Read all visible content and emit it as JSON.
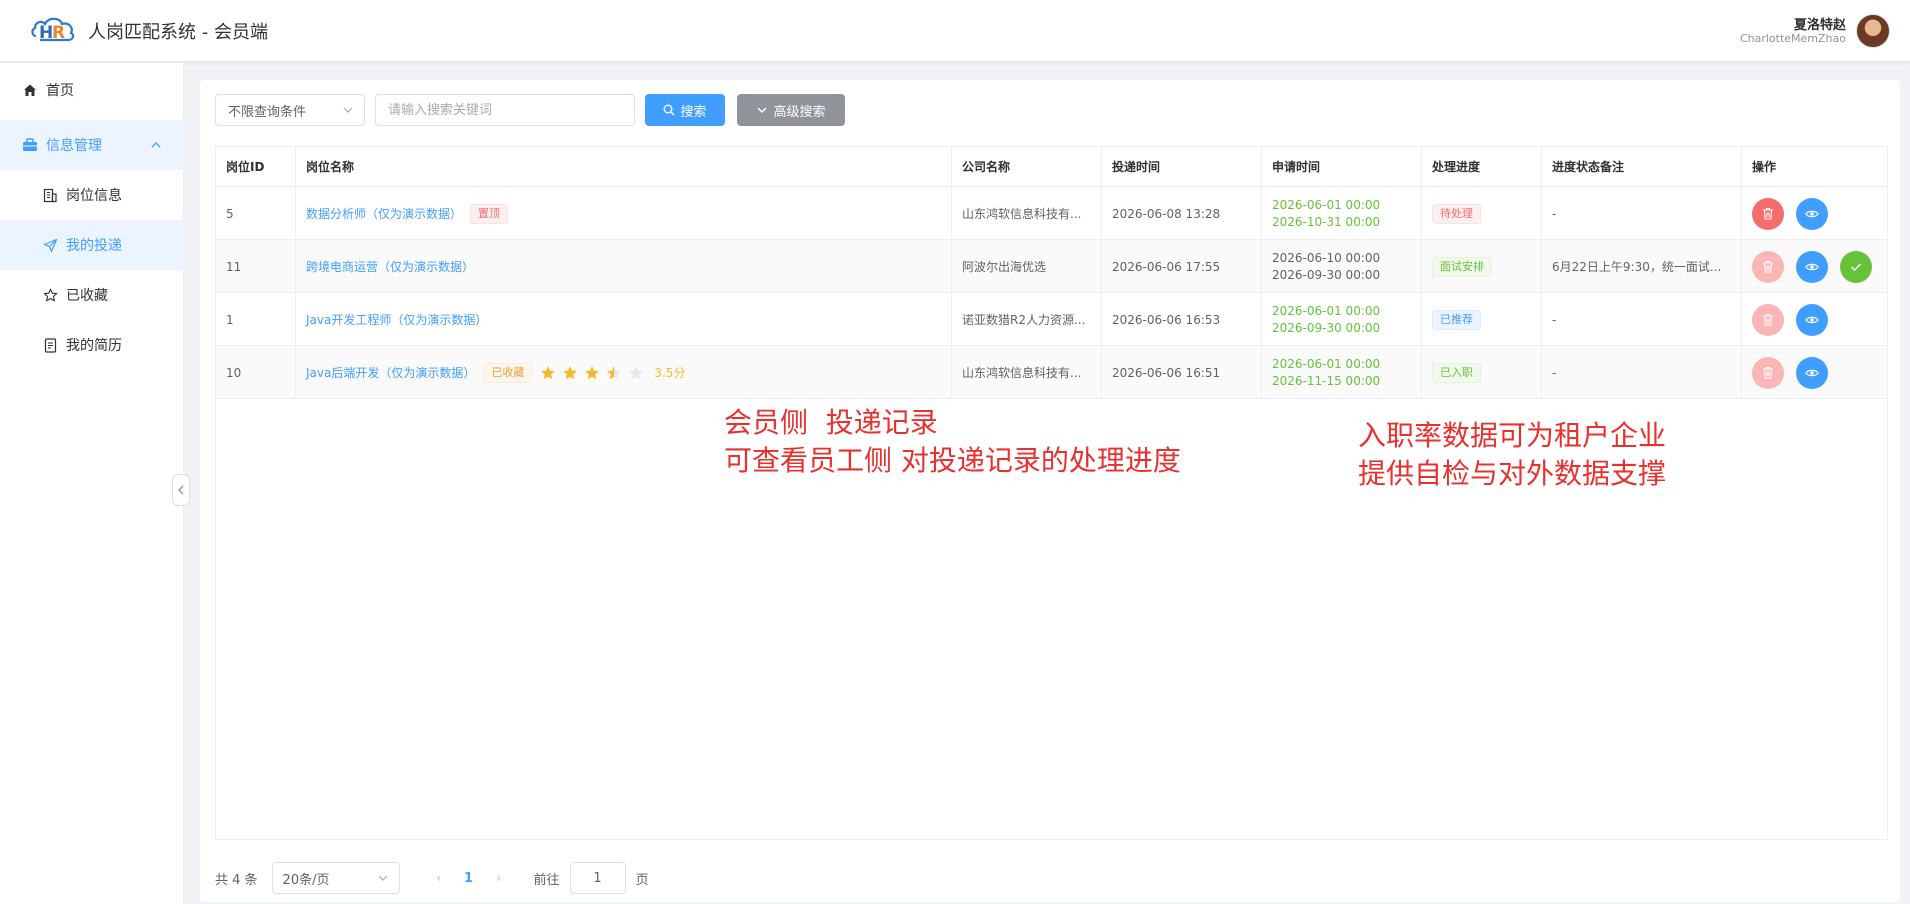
{
  "header": {
    "title": "人岗匹配系统 - 会员端",
    "user_name": "夏洛特赵",
    "user_sub": "CharlotteMemZhao"
  },
  "sidebar": {
    "home": "首页",
    "group": "信息管理",
    "items": [
      {
        "label": "岗位信息",
        "icon": "building-icon"
      },
      {
        "label": "我的投递",
        "icon": "send-icon"
      },
      {
        "label": "已收藏",
        "icon": "star-icon"
      },
      {
        "label": "我的简历",
        "icon": "document-icon"
      }
    ]
  },
  "filters": {
    "condition": "不限查询条件",
    "search_placeholder": "请输入搜索关键词",
    "search_label": "搜索",
    "advanced_label": "高级搜索"
  },
  "table": {
    "headers": [
      "岗位ID",
      "岗位名称",
      "公司名称",
      "投递时间",
      "申请时间",
      "处理进度",
      "进度状态备注",
      "操作"
    ],
    "rows": [
      {
        "id": "5",
        "job": "数据分析师（仅为演示数据）",
        "badge": "置顶",
        "company": "山东鸿软信息科技有...",
        "submit_time": "2026-06-08 13:28",
        "apply_start": "2026-06-01 00:00",
        "apply_end": "2026-10-31 00:00",
        "status": "待处理",
        "note": "-"
      },
      {
        "id": "11",
        "job": "跨境电商运营（仅为演示数据）",
        "badge": "",
        "company": "阿波尔出海优选",
        "submit_time": "2026-06-06 17:55",
        "apply_start": "2026-06-10 00:00",
        "apply_end": "2026-09-30 00:00",
        "status": "面试安排",
        "note": "6月22日上午9:30，统一面试..."
      },
      {
        "id": "1",
        "job": "Java开发工程师（仅为演示数据）",
        "badge": "",
        "company": "诺亚数猎R2人力资源...",
        "submit_time": "2026-06-06 16:53",
        "apply_start": "2026-06-01 00:00",
        "apply_end": "2026-09-30 00:00",
        "status": "已推荐",
        "note": "-"
      },
      {
        "id": "10",
        "job": "Java后端开发（仅为演示数据）",
        "badge": "已收藏",
        "rating": 3.5,
        "rating_label": "3.5分",
        "company": "山东鸿软信息科技有...",
        "submit_time": "2026-06-06 16:51",
        "apply_start": "2026-06-01 00:00",
        "apply_end": "2026-11-15 00:00",
        "status": "已入职",
        "note": "-"
      }
    ]
  },
  "annotations": {
    "left_line1": "会员侧  投递记录",
    "left_line2": "可查看员工侧 对投递记录的处理进度",
    "right_line1": "入职率数据可为租户企业",
    "right_line2": "提供自检与对外数据支撑"
  },
  "pagination": {
    "total": "共 4 条",
    "page_size": "20条/页",
    "current_page": "1",
    "goto_label": "前往",
    "goto_value": "1",
    "page_suffix": "页"
  },
  "colors": {
    "primary": "#409eff",
    "danger": "#f56c6c",
    "success": "#67c23a",
    "warning": "#e6a23c",
    "annotation": "#e8302e"
  }
}
